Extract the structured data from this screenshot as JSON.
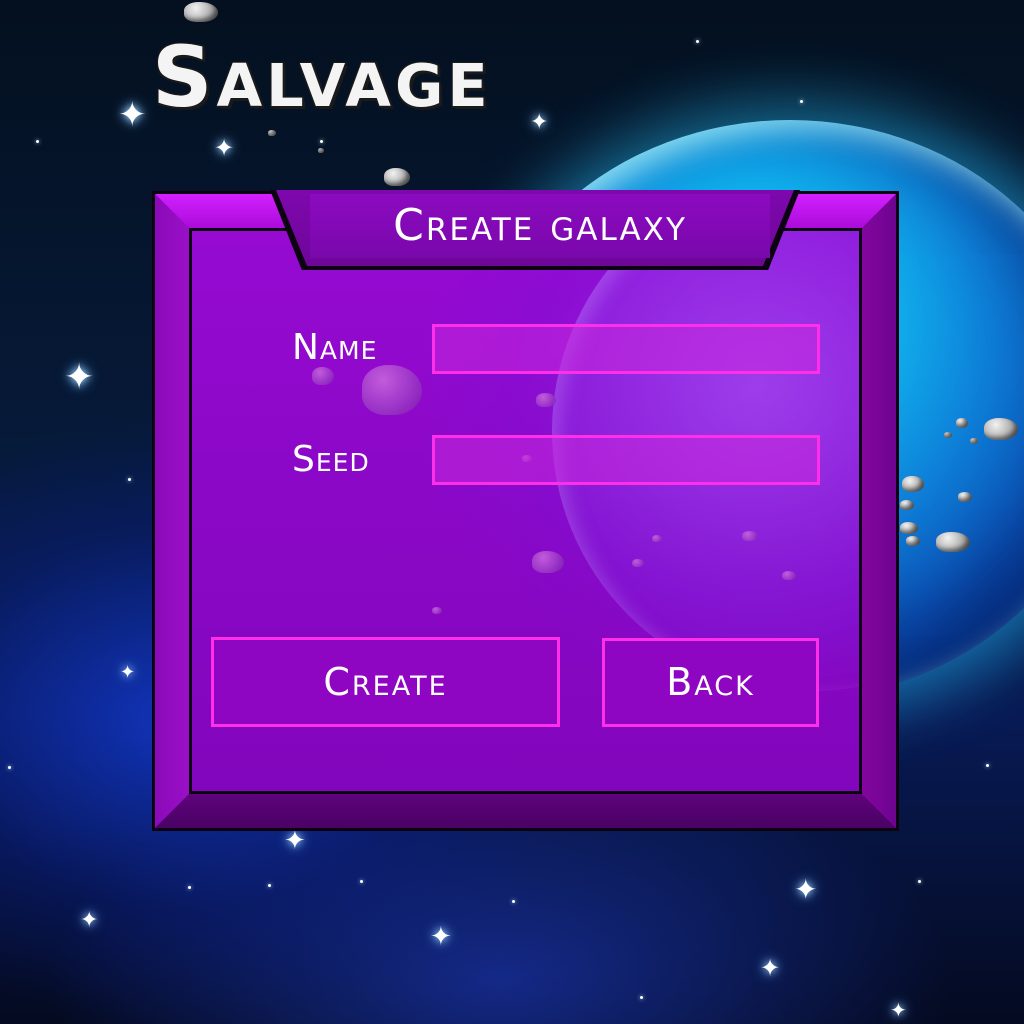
{
  "game": {
    "title": "Salvage"
  },
  "dialog": {
    "title": "Create galaxy",
    "fields": [
      {
        "label": "Name",
        "value": "",
        "placeholder": ""
      },
      {
        "label": "Seed",
        "value": "",
        "placeholder": ""
      }
    ],
    "buttons": {
      "create_label": "Create",
      "back_label": "Back"
    }
  },
  "colors": {
    "panel_purple": "#7a06a6",
    "field_border_pink": "#ff2ee8",
    "planet_cyan": "#1ad8ff",
    "space_navy": "#061a3a"
  },
  "icons": {
    "star_glyph": "✦"
  }
}
